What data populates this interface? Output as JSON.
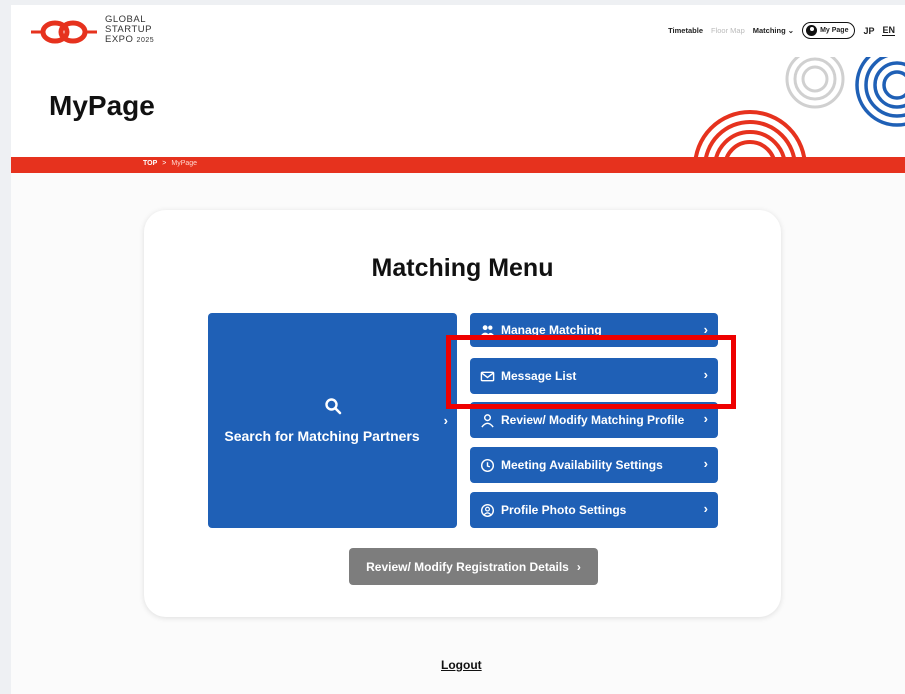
{
  "logo": {
    "line1": "GLOBAL",
    "line2": "STARTUP",
    "line3": "EXPO",
    "year": "2025"
  },
  "topnav": {
    "timetable": "Timetable",
    "floor_map": "Floor Map",
    "matching": "Matching",
    "mypage": "My Page",
    "lang_jp": "JP",
    "lang_en": "EN"
  },
  "hero": {
    "title": "MyPage"
  },
  "breadcrumb": {
    "home": "TOP",
    "separator": ">",
    "current": "MyPage"
  },
  "menu": {
    "title": "Matching Menu",
    "search_label": "Search for Matching Partners",
    "buttons": [
      {
        "label": "Manage Matching",
        "icon": "people-icon"
      },
      {
        "label": "Message List",
        "icon": "mail-icon"
      },
      {
        "label": "Review/ Modify Matching Profile",
        "icon": "person-icon"
      },
      {
        "label": "Meeting Availability Settings",
        "icon": "clock-icon"
      },
      {
        "label": "Profile Photo Settings",
        "icon": "user-circle-icon"
      }
    ],
    "registration_button": "Review/ Modify Registration Details"
  },
  "logout": "Logout",
  "colors": {
    "brand_blue": "#1f60b6",
    "brand_red": "#e6321e",
    "highlight": "#ee0000",
    "gray_button": "#7d7d7d"
  }
}
